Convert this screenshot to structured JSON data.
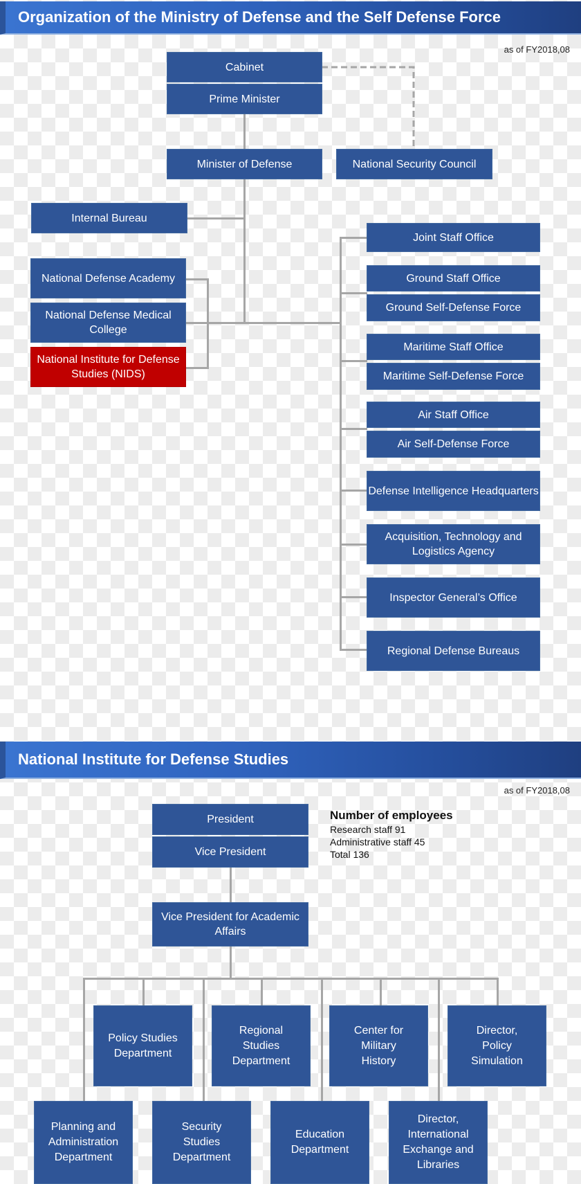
{
  "section1": {
    "title": "Organization of the Ministry of Defense and the Self Defense Force",
    "as_of": "as of FY2018,08",
    "top": {
      "cabinet": "Cabinet",
      "prime_minister": "Prime Minister",
      "minister_of_defense": "Minister of Defense",
      "national_security_council": "National Security Council"
    },
    "left_units": {
      "internal_bureau": "Internal Bureau",
      "academy": "National Defense Academy",
      "medical_college": "National Defense Medical College",
      "nids": "National Institute for Defense Studies (NIDS)"
    },
    "right_units": [
      "Joint Staff Office",
      "Ground Staff Office",
      "Ground Self-Defense Force",
      "Maritime Staff Office",
      "Maritime Self-Defense Force",
      "Air Staff Office",
      "Air Self-Defense Force",
      "Defense Intelligence Headquarters",
      "Acquisition, Technology and Logistics Agency",
      "Inspector General’s Office",
      "Regional Defense Bureaus"
    ],
    "highlight_color": "#c00000",
    "box_color": "#2f5597"
  },
  "section2": {
    "title": "National Institute for Defense Studies",
    "as_of": "as of FY2018,08",
    "president": "President",
    "vice_president": "Vice President",
    "vp_academic": "Vice President for Academic Affairs",
    "employees": {
      "title": "Number of employees",
      "research": "Research staff 91",
      "administrative": "Administrative staff 45",
      "total": "Total 136"
    },
    "upper_departments": [
      "Policy Studies Department",
      "Regional Studies Department",
      "Center for Military History",
      "Director, Policy Simulation"
    ],
    "lower_departments": [
      "Planning and Administration Department",
      "Security Studies Department",
      "Education Department",
      "Director, International Exchange and Libraries"
    ]
  }
}
